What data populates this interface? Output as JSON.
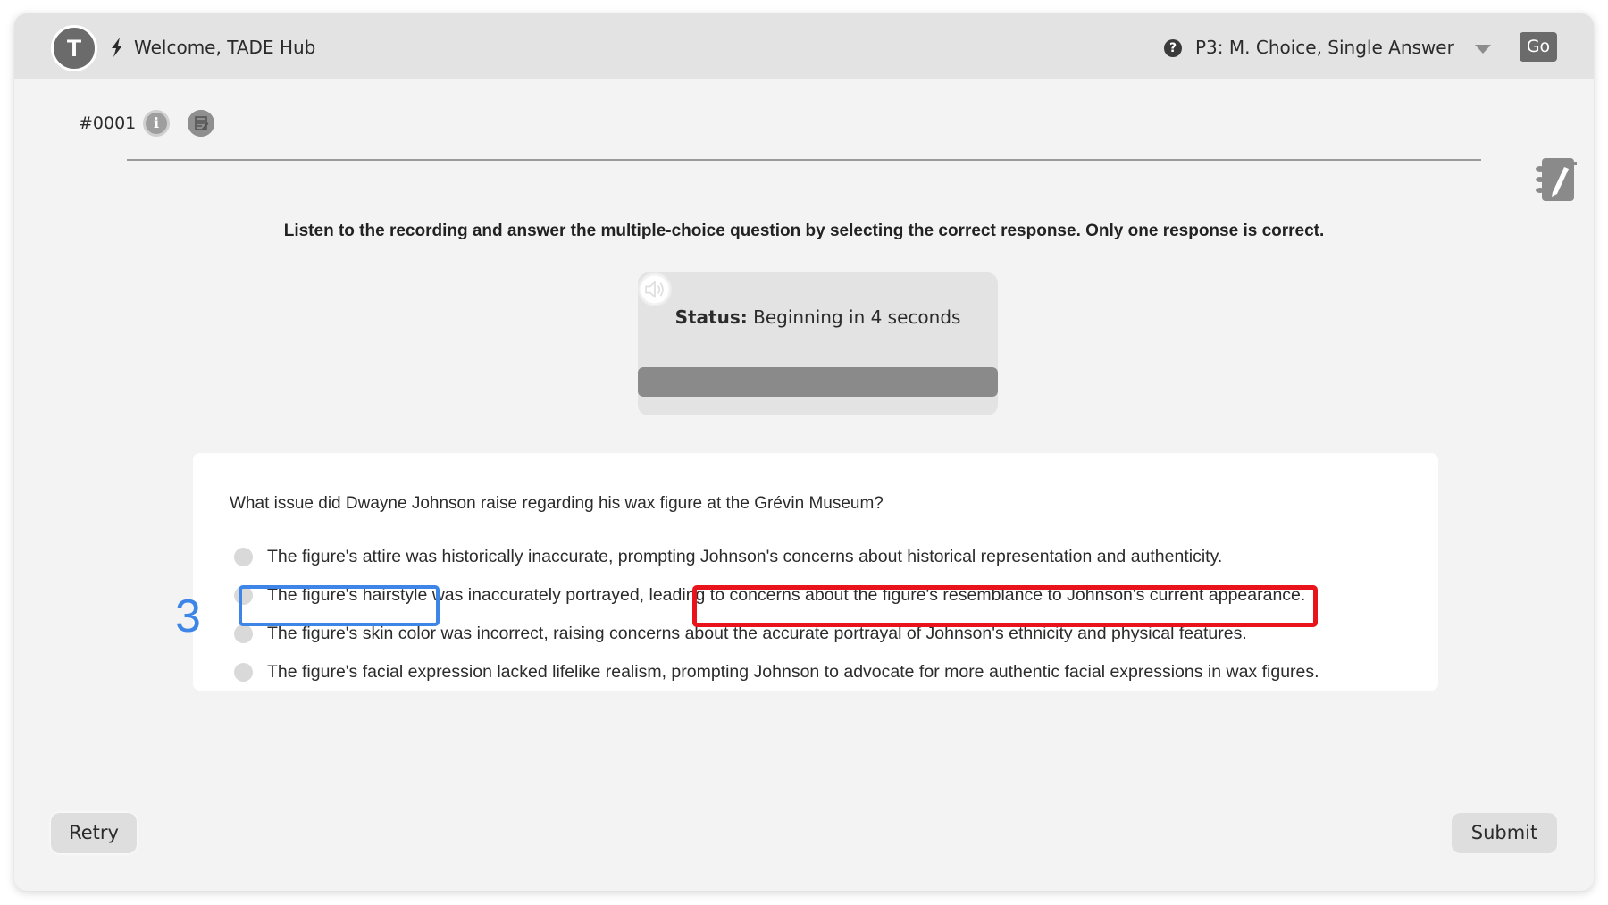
{
  "header": {
    "avatar_initial": "T",
    "welcome_text": "Welcome, TADE Hub",
    "question_type": "P3: M. Choice, Single Answer",
    "go_label": "Go"
  },
  "item": {
    "id": "#0001",
    "info_icon": "info-icon",
    "notes_icon": "notes-icon"
  },
  "instruction": "Listen to the recording and answer the multiple-choice question by selecting the correct response. Only one response is correct.",
  "audio": {
    "status_label": "Status:",
    "status_value": "Beginning in 4 seconds",
    "progress_percent": 100
  },
  "question": {
    "text": "What issue did Dwayne Johnson raise regarding his wax figure at the Grévin Museum?",
    "options": [
      {
        "text": "The figure's attire was historically inaccurate, prompting Johnson's concerns about historical representation and authenticity.",
        "selected": false
      },
      {
        "text": "The figure's hairstyle was inaccurately portrayed, leading to concerns about the figure's resemblance to Johnson's current appearance.",
        "selected": false
      },
      {
        "text_a": "The figure's skin color",
        "text_b": " was incorrect, raising concerns",
        "text_c": " about the accurate portrayal of Johnson's ethnicity and physical features.",
        "selected": false
      },
      {
        "text": "The figure's facial expression lacked lifelike realism, prompting Johnson to advocate for more authentic facial expressions in wax figures.",
        "selected": false
      }
    ]
  },
  "annotation": {
    "number": "3",
    "blue_color": "#3d86e8",
    "red_color": "#e8131b"
  },
  "footer": {
    "retry_label": "Retry",
    "submit_label": "Submit"
  }
}
